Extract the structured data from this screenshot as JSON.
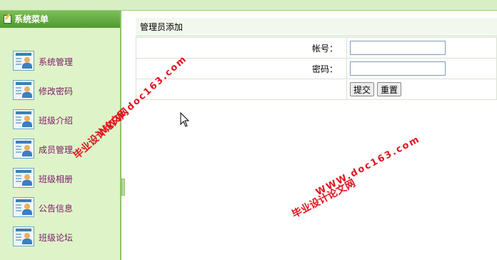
{
  "sidebar": {
    "title": "系统菜单",
    "items": [
      {
        "label": "系统管理",
        "icon": "user-card-icon"
      },
      {
        "label": "修改密码",
        "icon": "user-card-icon"
      },
      {
        "label": "班级介绍",
        "icon": "user-card-icon"
      },
      {
        "label": "成员管理",
        "icon": "user-card-icon"
      },
      {
        "label": "班级相册",
        "icon": "user-card-icon"
      },
      {
        "label": "公告信息",
        "icon": "user-card-icon"
      },
      {
        "label": "班级论坛",
        "icon": "user-card-icon"
      }
    ]
  },
  "main": {
    "panel_title": "管理员添加",
    "fields": [
      {
        "label": "帐号：",
        "value": ""
      },
      {
        "label": "密码：",
        "value": ""
      }
    ],
    "submit_label": "提交",
    "reset_label": "重置"
  },
  "watermark": {
    "site_name": "毕业设计论文网",
    "url": "WWW.doc163.com"
  },
  "colors": {
    "sidebar_bg": "#dff3c8",
    "header_green": "#5ca83a",
    "menu_text": "#7a1a6a",
    "watermark_red": "#e0141e"
  }
}
